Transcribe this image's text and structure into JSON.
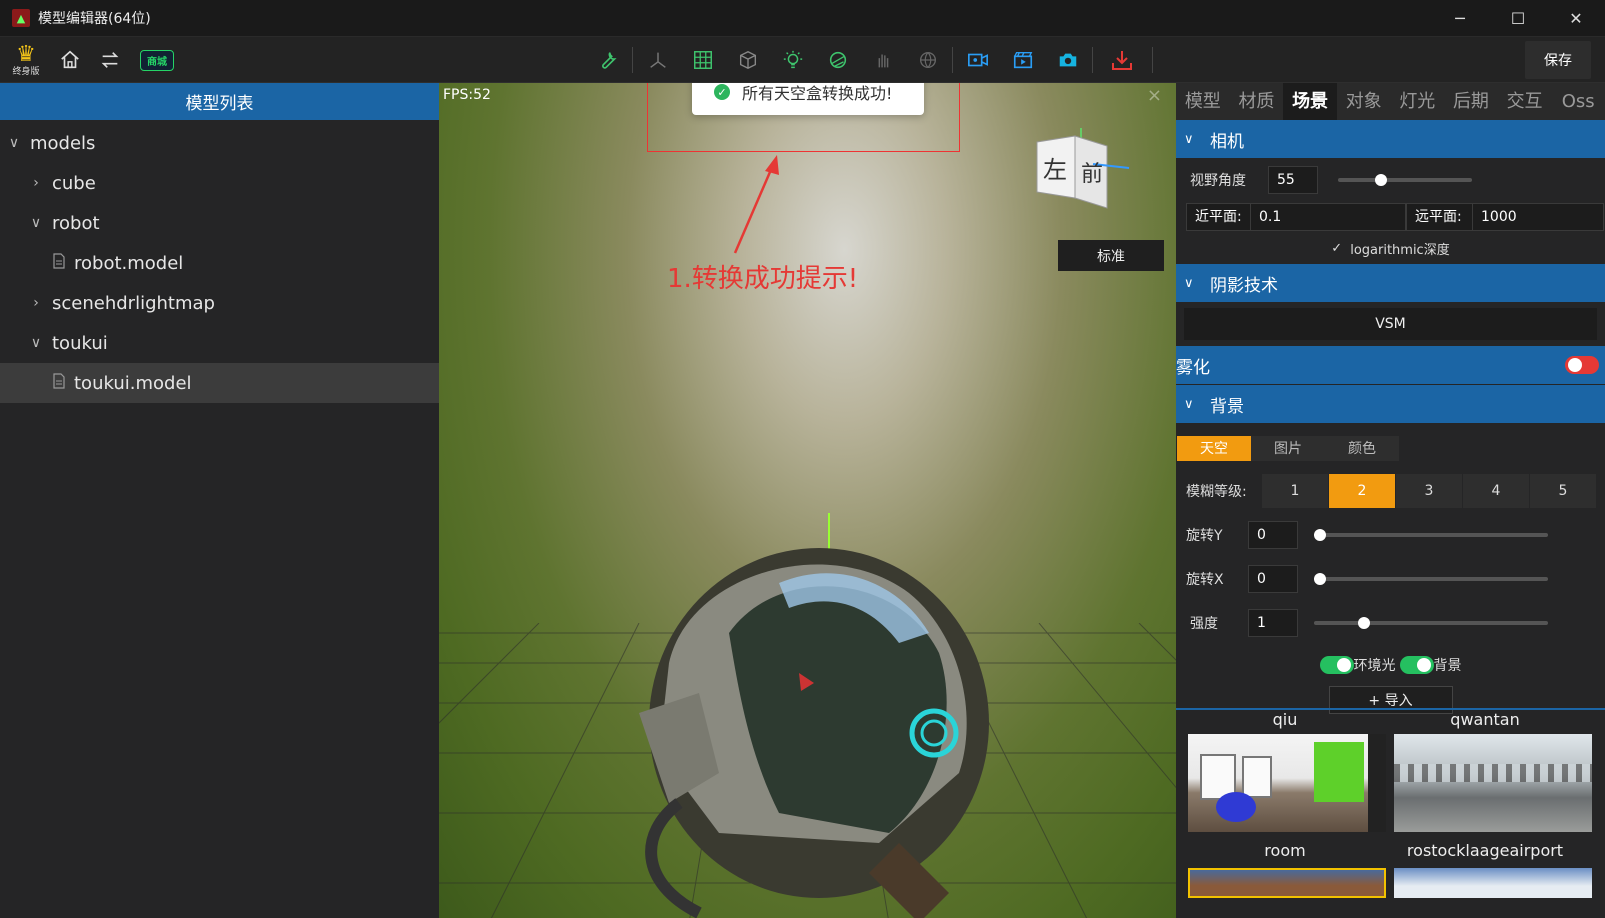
{
  "window": {
    "title": "模型编辑器(64位)",
    "minimize": "─",
    "maximize": "☐",
    "close": "✕"
  },
  "toolbar": {
    "edition_label": "终身版",
    "shop_label": "商城",
    "save_label": "保存"
  },
  "left_panel": {
    "header": "模型列表",
    "tree": [
      {
        "label": "models",
        "level": 0,
        "expanded": true,
        "type": "folder"
      },
      {
        "label": "cube",
        "level": 1,
        "expanded": false,
        "type": "folder"
      },
      {
        "label": "robot",
        "level": 1,
        "expanded": true,
        "type": "folder"
      },
      {
        "label": "robot.model",
        "level": 2,
        "type": "file"
      },
      {
        "label": "scenehdrlightmap",
        "level": 1,
        "expanded": false,
        "type": "folder"
      },
      {
        "label": "toukui",
        "level": 1,
        "expanded": true,
        "type": "folder"
      },
      {
        "label": "toukui.model",
        "level": 2,
        "type": "file",
        "selected": true
      }
    ]
  },
  "viewport": {
    "fps": "FPS:52",
    "toast": "所有天空盒转换成功!",
    "annotation": "1.转换成功提示!",
    "cube_left": "左",
    "cube_front": "前",
    "std_button": "标准"
  },
  "right_panel": {
    "tabs": [
      "模型",
      "材质",
      "场景",
      "对象",
      "灯光",
      "后期",
      "交互",
      "Oss"
    ],
    "active_tab": "场景",
    "camera": {
      "title": "相机",
      "fov_label": "视野角度",
      "fov_value": "55",
      "fov_level": 0.3,
      "near_label": "近平面:",
      "near_value": "0.1",
      "far_label": "远平面:",
      "far_value": "1000",
      "log_depth_label": "logarithmic深度"
    },
    "shadow": {
      "title": "阴影技术",
      "value": "VSM"
    },
    "fog": {
      "title": "雾化"
    },
    "background": {
      "title": "背景",
      "tabs": [
        "天空",
        "图片",
        "颜色"
      ],
      "blur_label": "模糊等级:",
      "blur_levels": [
        "1",
        "2",
        "3",
        "4",
        "5"
      ],
      "blur_active": "2",
      "rotate_y_label": "旋转Y",
      "rotate_y_value": "0",
      "rotate_y_level": 0,
      "rotate_x_label": "旋转X",
      "rotate_x_value": "0",
      "rotate_x_level": 0,
      "intensity_label": "强度",
      "intensity_value": "1",
      "intensity_level": 0.2,
      "env_light_label": "环境光",
      "bg_label": "背景",
      "import_label": "+ 导入",
      "thumbs_top_names": [
        "qiu",
        "qwantan"
      ],
      "thumbs_bottom_names": [
        "room",
        "rostocklaageairport"
      ]
    }
  },
  "colors": {
    "accent_blue": "#1b65a5",
    "accent_orange": "#f29b10",
    "toggle_on": "#25c060",
    "toggle_off": "#e53935",
    "annotation_red": "#e53935"
  }
}
